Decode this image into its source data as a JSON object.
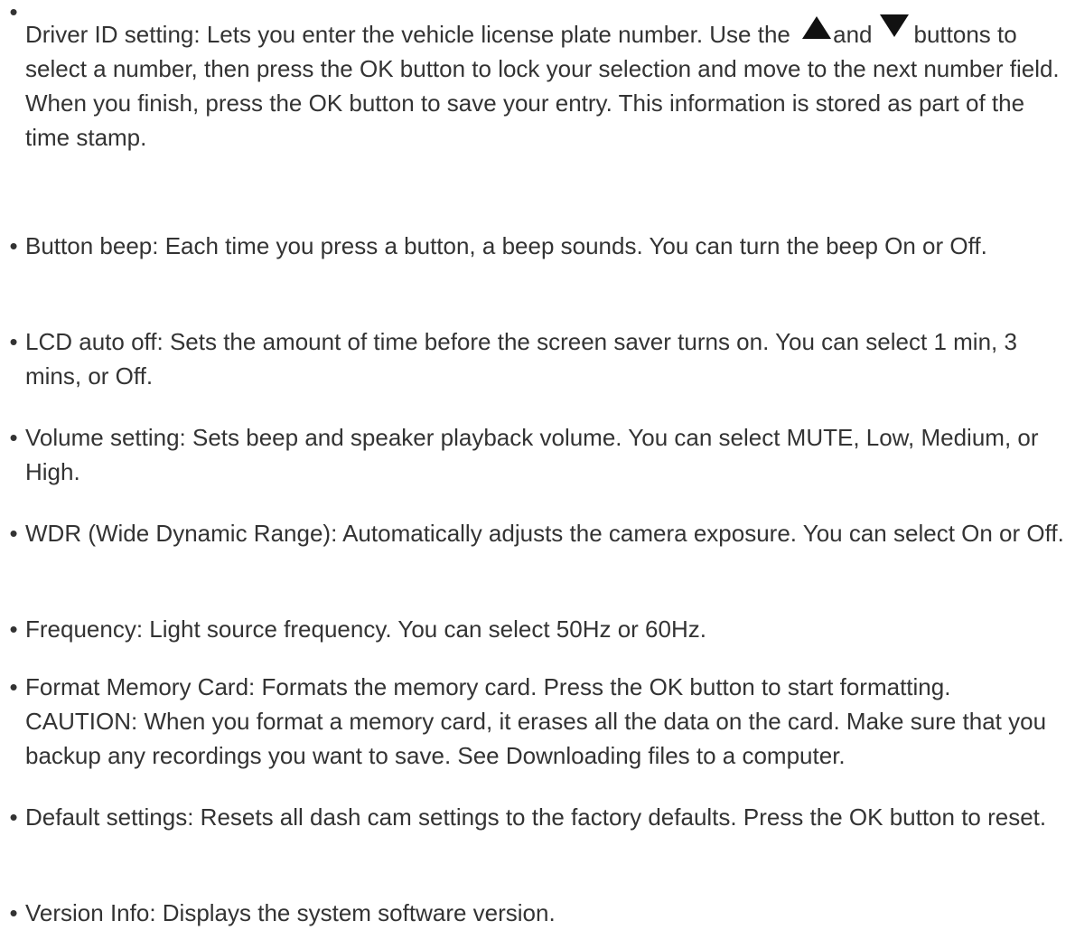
{
  "items": [
    {
      "label": "Driver ID setting:",
      "parts": [
        " Lets you enter the vehicle license plate number. Use the ",
        "and",
        "buttons to select a number, then press the OK button to lock your selection and move to the next number field. When you finish, press the OK button to save your entry. This information is stored as part of the time stamp."
      ],
      "icons": [
        "up-triangle-icon",
        "down-triangle-icon"
      ]
    },
    {
      "label": "Button beep:",
      "text": " Each time you press a button, a beep sounds. You can turn the beep On or Off."
    },
    {
      "label": "LCD auto off:",
      "text": " Sets the amount of time before the screen saver turns on. You can select 1 min, 3 mins, or Off."
    },
    {
      "label": "Volume setting:",
      "text": " Sets beep and speaker playback volume. You can select MUTE, Low, Medium, or High."
    },
    {
      "label": "WDR (Wide Dynamic Range):",
      "text": " Automatically adjusts the camera exposure. You can select On or Off."
    },
    {
      "label": "Frequency:",
      "text": " Light source frequency. You can select 50Hz or 60Hz."
    },
    {
      "label": "Format Memory Card:",
      "text": " Formats the memory card. Press the OK button to start formatting. CAUTION: When you format a memory card, it erases all the data on the card. Make sure that you backup any recordings you want to save. See Downloading files to a computer."
    },
    {
      "label": "Default settings:",
      "text": " Resets all dash cam settings to the factory defaults. Press the OK button to reset."
    },
    {
      "label": "Version Info:",
      "text": " Displays the system software version."
    }
  ],
  "bullet": "•"
}
